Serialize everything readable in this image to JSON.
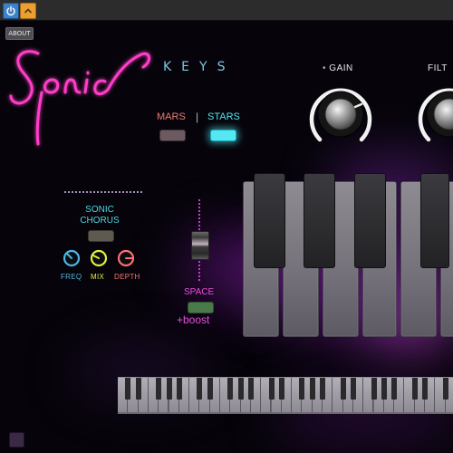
{
  "window": {
    "power_icon": "power-icon",
    "collapse_icon": "chevron-up-icon",
    "about_label": "ABOUT"
  },
  "brand": {
    "logo_text": "Sonic",
    "subtitle": "KEYS",
    "logo_color": "#ff3ec8"
  },
  "mode": {
    "mars_label": "MARS",
    "divider": "|",
    "stars_label": "STARS",
    "selected": "STARS",
    "mars_color": "#f07a72",
    "stars_color": "#54e3ee"
  },
  "chorus": {
    "title_line1": "SONIC",
    "title_line2": "CHORUS",
    "enabled": false,
    "knobs": [
      {
        "label": "FREQ",
        "color": "#4fb6e0"
      },
      {
        "label": "MIX",
        "color": "#e5ef3a"
      },
      {
        "label": "DEPTH",
        "color": "#ff6f6f"
      }
    ]
  },
  "space": {
    "label": "SPACE",
    "boost_label": "+boost",
    "enabled": false,
    "accent": "#e64fd8"
  },
  "gain": {
    "label": "GAIN"
  },
  "filter": {
    "label": "FILT"
  },
  "colors": {
    "background": "#06040a",
    "glow": "#9a2bd0"
  }
}
